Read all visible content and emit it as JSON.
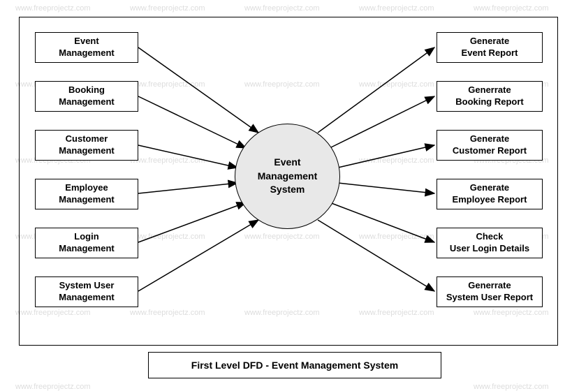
{
  "watermark": "www.freeprojectz.com",
  "center": "Event\nManagement\nSystem",
  "left_boxes": [
    "Event\nManagement",
    "Booking\nManagement",
    "Customer\nManagement",
    "Employee\nManagement",
    "Login\nManagement",
    "System User\nManagement"
  ],
  "right_boxes": [
    "Generate\nEvent Report",
    "Generrate\nBooking Report",
    "Generate\nCustomer Report",
    "Generate\nEmployee Report",
    "Check\nUser Login Details",
    "Generrate\nSystem User Report"
  ],
  "title": "First Level DFD - Event Management System"
}
